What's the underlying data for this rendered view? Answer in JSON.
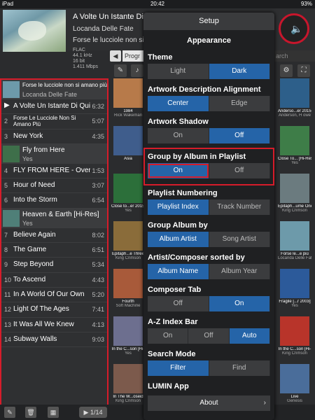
{
  "status": {
    "device": "iPad",
    "time": "20:42",
    "battery": "93%"
  },
  "now_playing": {
    "title": "A Volte Un Istante Di Quiete",
    "artist": "Locanda Delle Fate",
    "album": "Forse le lucciole non si amano più",
    "format": "FLAC",
    "rate": "44.1 kHz",
    "bits": "16 bit",
    "bitrate": "1.411 Mbps",
    "volume_icon": "speaker-icon"
  },
  "toolbar": {
    "progress_tab": "Progr",
    "search_placeholder": "arch"
  },
  "playlist": [
    {
      "type": "header",
      "title": "Forse le lucciole non si amano più",
      "subtitle": "Locanda Delle Fate",
      "color": "#6d9aaa"
    },
    {
      "type": "track",
      "num": "▶",
      "title": "A Volte Un Istante Di Quiete",
      "dur": "6:32",
      "playing": true
    },
    {
      "type": "track",
      "num": "2",
      "title": "Forse Le Lucciole Non Si Amano Più",
      "dur": "5:07",
      "two": true
    },
    {
      "type": "track",
      "num": "3",
      "title": "New York",
      "dur": "4:35"
    },
    {
      "type": "header",
      "title": "Fly from Here",
      "subtitle": "Yes",
      "color": "#3e6f4a"
    },
    {
      "type": "track",
      "num": "4",
      "title": "FLY FROM HERE - Overture",
      "dur": "1:53"
    },
    {
      "type": "track",
      "num": "5",
      "title": "Hour of Need",
      "dur": "3:07"
    },
    {
      "type": "track",
      "num": "6",
      "title": "Into the Storm",
      "dur": "6:54"
    },
    {
      "type": "header",
      "title": "Heaven & Earth [Hi-Res]",
      "subtitle": "Yes",
      "color": "#4f7f78"
    },
    {
      "type": "track",
      "num": "7",
      "title": "Believe Again",
      "dur": "8:02"
    },
    {
      "type": "track",
      "num": "8",
      "title": "The Game",
      "dur": "6:51"
    },
    {
      "type": "track",
      "num": "9",
      "title": "Step Beyond",
      "dur": "5:34"
    },
    {
      "type": "track",
      "num": "10",
      "title": "To Ascend",
      "dur": "4:43"
    },
    {
      "type": "track",
      "num": "11",
      "title": "In A World Of Our Own",
      "dur": "5:20"
    },
    {
      "type": "track",
      "num": "12",
      "title": "Light Of The Ages",
      "dur": "7:41"
    },
    {
      "type": "track",
      "num": "13",
      "title": "It Was All We Knew",
      "dur": "4:13"
    },
    {
      "type": "track",
      "num": "14",
      "title": "Subway Walls",
      "dur": "9:03"
    }
  ],
  "albums_left": [
    {
      "t": "1984",
      "a": "Rick Wakeman",
      "c": "#b77a4a"
    },
    {
      "t": "Asia",
      "a": "",
      "c": "#3f5d8c"
    },
    {
      "t": "Close to...er 2015]",
      "a": "Yes",
      "c": "#2c6f3a"
    },
    {
      "t": "Epitaph...e Three",
      "a": "King Crimson",
      "c": "#8a6c3a"
    },
    {
      "t": "Fourth",
      "a": "Soft Machine",
      "c": "#a85a3a"
    },
    {
      "t": "In the C...son [Hi-",
      "a": "Yes",
      "c": "#6d6f8f"
    },
    {
      "t": "In The W...oseid",
      "a": "King Crimson",
      "c": "#7c5a4c"
    }
  ],
  "albums_right": [
    {
      "t": "Anderso...er 2015]",
      "a": "Anderson, H owe",
      "c": "#2d5f8a"
    },
    {
      "t": "Close To... [Hi-Res]",
      "a": "Yes",
      "c": "#3e7d48"
    },
    {
      "t": "Epitaph...ume One",
      "a": "King Crimson",
      "c": "#6b7b7f"
    },
    {
      "t": "Forse le...e più",
      "a": "Locanda Delle Fate",
      "c": "#6d9aaa"
    },
    {
      "t": "Fragile [...r 2003]",
      "a": "Yes",
      "c": "#2c5a9a"
    },
    {
      "t": "In the C...son [Hi-",
      "a": "King Crimson",
      "c": "#b8342a"
    },
    {
      "t": "Live",
      "a": "Genesis",
      "c": "#4a6d9a"
    }
  ],
  "bottom": {
    "count": "1/14"
  },
  "settings": {
    "title": "Setup",
    "subtitle": "Appearance",
    "sections": [
      {
        "label": "Theme",
        "options": [
          "Light",
          "Dark"
        ],
        "selected": 1
      },
      {
        "label": "Artwork Description Alignment",
        "options": [
          "Center",
          "Edge"
        ],
        "selected": 0
      },
      {
        "label": "Artwork Shadow",
        "options": [
          "On",
          "Off"
        ],
        "selected": 1
      },
      {
        "label": "Group by Album in Playlist",
        "options": [
          "On",
          "Off"
        ],
        "selected": 0,
        "highlight": true
      },
      {
        "label": "Playlist Numbering",
        "options": [
          "Playlist Index",
          "Track Number"
        ],
        "selected": 0
      },
      {
        "label": "Group Album by",
        "options": [
          "Album Artist",
          "Song Artist"
        ],
        "selected": 0
      },
      {
        "label": "Artist/Composer sorted by",
        "options": [
          "Album Name",
          "Album Year"
        ],
        "selected": 0
      },
      {
        "label": "Composer Tab",
        "options": [
          "Off",
          "On"
        ],
        "selected": 1
      },
      {
        "label": "A-Z Index Bar",
        "options": [
          "On",
          "Off",
          "Auto"
        ],
        "selected": 2
      },
      {
        "label": "Search Mode",
        "options": [
          "Filter",
          "Find"
        ],
        "selected": 0
      },
      {
        "label": "LUMIN App",
        "options": [],
        "selected": -1
      }
    ],
    "about_label": "About"
  }
}
